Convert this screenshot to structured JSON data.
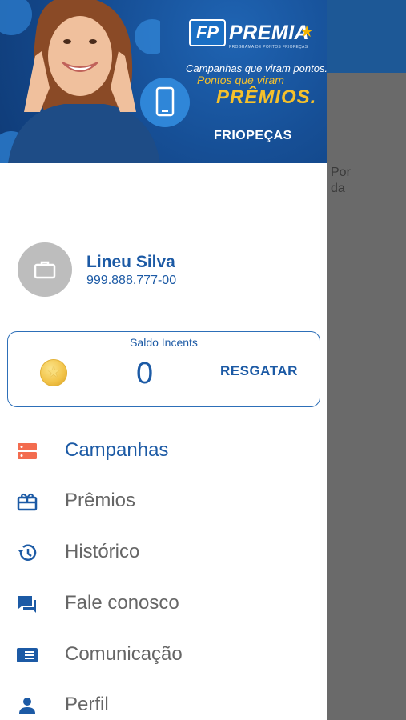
{
  "background": {
    "snippet_text": "Por\nda"
  },
  "banner": {
    "brand_fp": "FP",
    "brand_name": "PREMIA",
    "brand_subtitle": "PROGRAMA DE PONTOS FRIOPEÇAS",
    "tagline_line1": "Campanhas que viram pontos.",
    "tagline_line2": "Pontos que viram",
    "tagline_line3": "PRÊMIOS.",
    "company": "FRIOPEÇAS"
  },
  "user": {
    "name": "Lineu Silva",
    "document": "999.888.777-00"
  },
  "balance_card": {
    "title": "Saldo Incents",
    "value": "0",
    "action_label": "RESGATAR"
  },
  "menu": {
    "items": [
      {
        "label": "Campanhas",
        "icon": "campaigns-icon",
        "active": true
      },
      {
        "label": "Prêmios",
        "icon": "gift-icon",
        "active": false
      },
      {
        "label": "Histórico",
        "icon": "history-icon",
        "active": false
      },
      {
        "label": "Fale conosco",
        "icon": "chat-icon",
        "active": false
      },
      {
        "label": "Comunicação",
        "icon": "newsletter-icon",
        "active": false
      },
      {
        "label": "Perfil",
        "icon": "person-icon",
        "active": false
      }
    ]
  },
  "colors": {
    "primary": "#1c5aa5",
    "active_icon": "#f36c4f",
    "inactive_text": "#666666",
    "banner_blue": "#164f96"
  }
}
